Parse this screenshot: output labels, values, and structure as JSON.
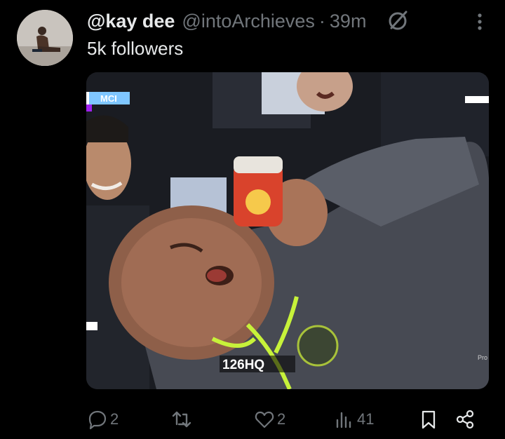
{
  "post": {
    "display_name": "@kay dee",
    "handle": "@intoArchieves",
    "separator": "·",
    "time": "39m",
    "text": "5k followers",
    "media": {
      "scoreboard_badge": "MCI",
      "watermark": "126HQ",
      "corner_text": "Pro"
    }
  },
  "actions": {
    "replies": "2",
    "reposts": "",
    "likes": "2",
    "views": "41"
  },
  "icons": {
    "grok": "grok-icon",
    "more": "more-vertical-icon",
    "reply": "reply-icon",
    "repost": "repost-icon",
    "like": "heart-icon",
    "views": "views-icon",
    "bookmark": "bookmark-icon",
    "share": "share-icon"
  },
  "colors": {
    "background": "#000000",
    "text_primary": "#e7e9ea",
    "text_secondary": "#71767b"
  }
}
